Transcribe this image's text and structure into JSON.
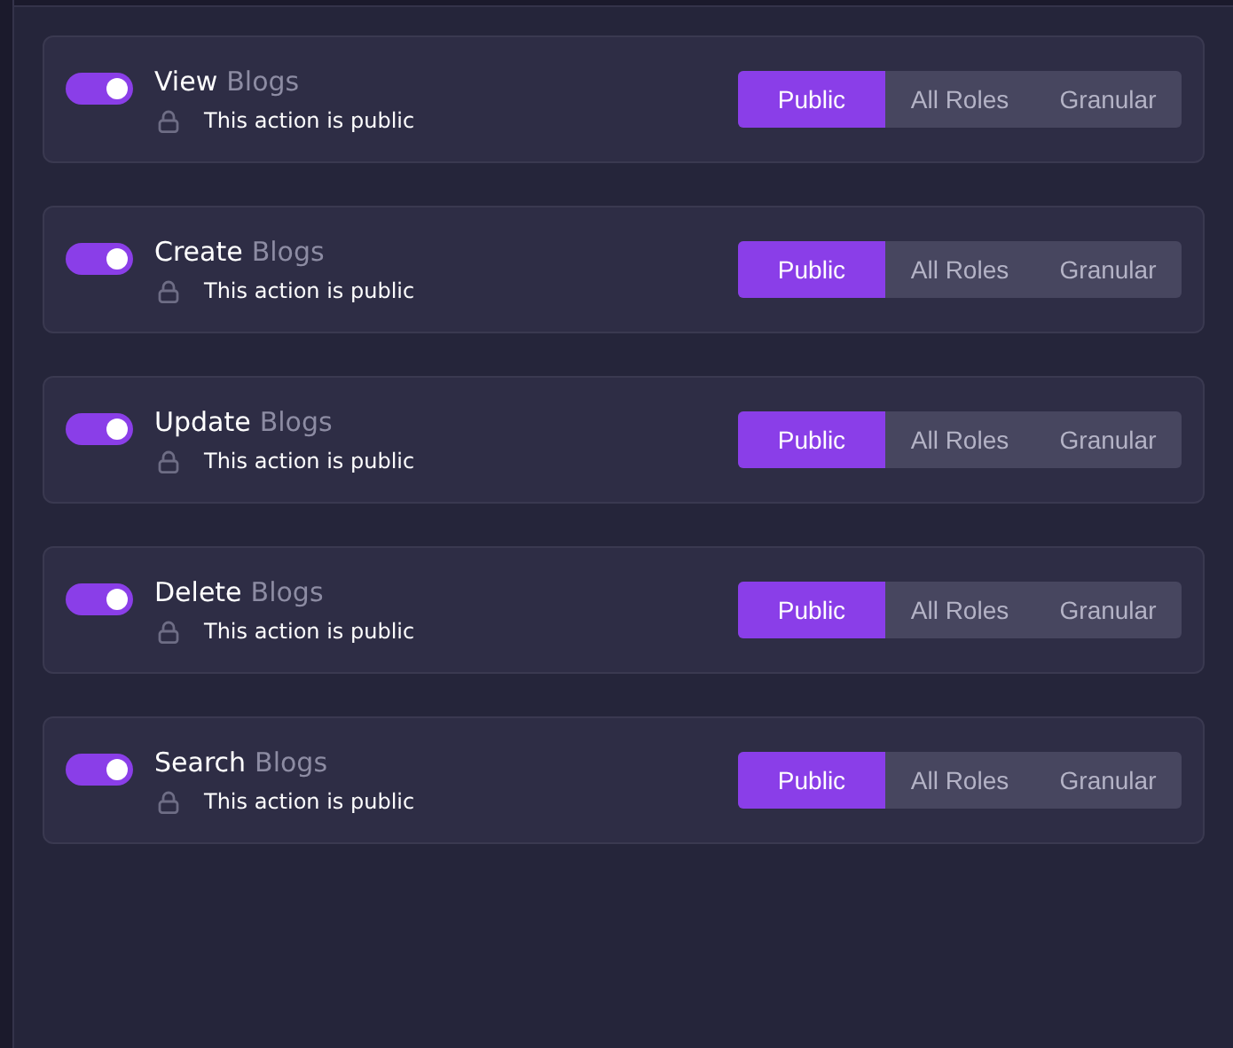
{
  "permissions": [
    {
      "action": "View",
      "resource": "Blogs",
      "enabled": true,
      "note": "This action is public",
      "access": [
        {
          "label": "Public",
          "selected": true
        },
        {
          "label": "All Roles",
          "selected": false
        },
        {
          "label": "Granular",
          "selected": false
        }
      ]
    },
    {
      "action": "Create",
      "resource": "Blogs",
      "enabled": true,
      "note": "This action is public",
      "access": [
        {
          "label": "Public",
          "selected": true
        },
        {
          "label": "All Roles",
          "selected": false
        },
        {
          "label": "Granular",
          "selected": false
        }
      ]
    },
    {
      "action": "Update",
      "resource": "Blogs",
      "enabled": true,
      "note": "This action is public",
      "access": [
        {
          "label": "Public",
          "selected": true
        },
        {
          "label": "All Roles",
          "selected": false
        },
        {
          "label": "Granular",
          "selected": false
        }
      ]
    },
    {
      "action": "Delete",
      "resource": "Blogs",
      "enabled": true,
      "note": "This action is public",
      "access": [
        {
          "label": "Public",
          "selected": true
        },
        {
          "label": "All Roles",
          "selected": false
        },
        {
          "label": "Granular",
          "selected": false
        }
      ]
    },
    {
      "action": "Search",
      "resource": "Blogs",
      "enabled": true,
      "note": "This action is public",
      "access": [
        {
          "label": "Public",
          "selected": true
        },
        {
          "label": "All Roles",
          "selected": false
        },
        {
          "label": "Granular",
          "selected": false
        }
      ]
    }
  ]
}
